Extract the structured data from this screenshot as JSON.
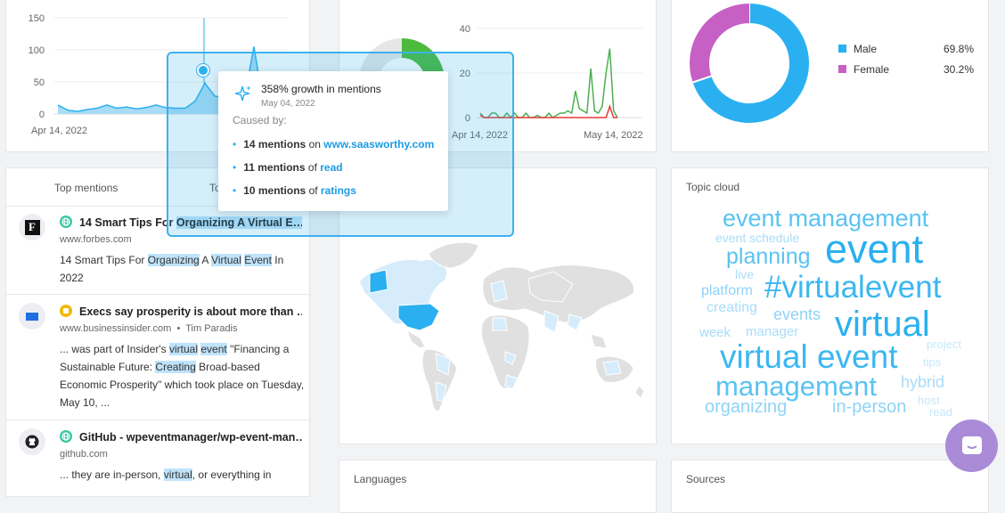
{
  "mentions_chart": {
    "y_ticks": [
      "150",
      "100",
      "50",
      "0"
    ],
    "x_start": "Apr 14, 2022",
    "chart_data": {
      "type": "area",
      "series": [
        {
          "values": [
            14,
            6,
            4,
            7,
            9,
            14,
            9,
            11,
            8,
            10,
            14,
            10,
            9,
            9,
            20,
            48,
            28,
            25,
            12,
            22,
            105,
            12,
            3
          ]
        }
      ],
      "ylim": [
        0,
        160
      ]
    }
  },
  "sentiment_chart": {
    "y_ticks": [
      "40",
      "20",
      "0"
    ],
    "x_start": "Apr 14, 2022",
    "x_end": "May 14, 2022",
    "chart_data": {
      "type": "line",
      "series": [
        {
          "color": "#4caf50",
          "values": [
            2,
            0,
            0,
            2,
            2,
            0,
            0,
            2,
            0,
            2,
            0,
            0,
            2,
            0,
            0,
            1,
            0,
            0,
            2,
            0,
            1,
            2,
            2,
            3,
            2,
            12,
            4,
            3,
            2,
            22,
            3,
            2,
            5,
            20,
            31,
            3,
            0
          ]
        },
        {
          "color": "#e53935",
          "values": [
            1,
            0,
            0,
            0,
            0,
            0,
            0,
            0,
            0,
            0,
            0,
            0,
            0,
            0,
            0,
            0,
            0,
            0,
            0,
            0,
            0,
            0,
            0,
            0,
            0,
            0,
            0,
            0,
            0,
            0,
            0,
            0,
            0,
            0,
            5,
            0,
            0
          ]
        }
      ],
      "ylim": [
        0,
        45
      ]
    }
  },
  "gender": {
    "chart_data": {
      "type": "pie",
      "labels": [
        "Male",
        "Female"
      ],
      "values": [
        69.8,
        30.2
      ],
      "colors": [
        "#2ab0f0",
        "#c760c4"
      ]
    },
    "items": [
      {
        "label": "Male",
        "value": "69.8%",
        "color": "#2ab0f0"
      },
      {
        "label": "Female",
        "value": "30.2%",
        "color": "#c760c4"
      }
    ]
  },
  "tooltip": {
    "title": "358% growth in mentions",
    "date": "May 04, 2022",
    "caused_by": "Caused by:",
    "items": [
      {
        "count": "14 mentions",
        "conj": " on ",
        "link": "www.saasworthy.com"
      },
      {
        "count": "11 mentions",
        "conj": " of ",
        "link": "read"
      },
      {
        "count": "10 mentions",
        "conj": " of ",
        "link": "ratings"
      }
    ]
  },
  "top_mentions": {
    "header_a": "Top mentions",
    "header_b": "To",
    "items": [
      {
        "icon": "F",
        "title_pre": "14 Smart Tips For ",
        "title_h1": "Organizing",
        "title_mid": " A ",
        "title_h2": "Virtual",
        "title_post": " E…",
        "source": "www.forbes.com",
        "author": "",
        "ex1": "14 Smart Tips For ",
        "exh1": "Organizing",
        "ex2": " A ",
        "exh2": "Virtual",
        "ex3": " ",
        "exh3": "Event",
        "ex4": " In 2022",
        "exh4": "",
        "ex5": ""
      },
      {
        "icon": "BI",
        "title_pre": "Execs say prosperity is about more than …",
        "title_h1": "",
        "title_mid": "",
        "title_h2": "",
        "title_post": "",
        "source": "www.businessinsider.com",
        "author": "Tim Paradis",
        "ex1": "... was part of Insider's ",
        "exh1": "virtual",
        "ex2": " ",
        "exh2": "event",
        "ex3": " \"Financing a Sustainable Future: ",
        "exh3": "Creating",
        "ex4": " Broad-based Economic Prosperity\" which took place on Tuesday, May 10, ...",
        "exh4": "",
        "ex5": ""
      },
      {
        "icon": "GH",
        "title_pre": "GitHub - wpeventmanager/wp-event-man…",
        "title_h1": "",
        "title_mid": "",
        "title_h2": "",
        "title_post": "",
        "source": "github.com",
        "author": "",
        "ex1": "... they are in-person, ",
        "exh1": "virtual",
        "ex2": ", or everything in",
        "exh2": "",
        "ex3": "",
        "exh3": "",
        "ex4": "",
        "exh4": "",
        "ex5": ""
      }
    ]
  },
  "topic_cloud": {
    "title": "Topic cloud",
    "words": [
      {
        "text": "event management",
        "size": 27,
        "color": "#59c3f3"
      },
      {
        "text": "event schedule",
        "size": 14,
        "color": "#a9dcf8"
      },
      {
        "text": "event",
        "size": 45,
        "color": "#2ab0f0"
      },
      {
        "text": "planning",
        "size": 25,
        "color": "#59c3f3"
      },
      {
        "text": "live",
        "size": 14,
        "color": "#a9dcf8"
      },
      {
        "text": "#virtualevent",
        "size": 35,
        "color": "#3bb7f1"
      },
      {
        "text": "platform",
        "size": 16,
        "color": "#8fd3f6"
      },
      {
        "text": "creating",
        "size": 16,
        "color": "#a9dcf8"
      },
      {
        "text": "events",
        "size": 18,
        "color": "#8fd3f6"
      },
      {
        "text": "virtual",
        "size": 40,
        "color": "#2ab0f0"
      },
      {
        "text": "week",
        "size": 15,
        "color": "#a9dcf8"
      },
      {
        "text": "manager",
        "size": 15,
        "color": "#a9dcf8"
      },
      {
        "text": "virtual event",
        "size": 37,
        "color": "#3bb7f1"
      },
      {
        "text": "project",
        "size": 13,
        "color": "#c5e8fa"
      },
      {
        "text": "tips",
        "size": 13,
        "color": "#c5e8fa"
      },
      {
        "text": "management",
        "size": 31,
        "color": "#59c3f3"
      },
      {
        "text": "hybrid",
        "size": 18,
        "color": "#a9dcf8"
      },
      {
        "text": "host",
        "size": 13,
        "color": "#c5e8fa"
      },
      {
        "text": "organizing",
        "size": 20,
        "color": "#8fd3f6"
      },
      {
        "text": "in-person",
        "size": 20,
        "color": "#8fd3f6"
      },
      {
        "text": "read",
        "size": 13,
        "color": "#c5e8fa"
      }
    ]
  },
  "languages_title": "Languages",
  "sources_title": "Sources"
}
